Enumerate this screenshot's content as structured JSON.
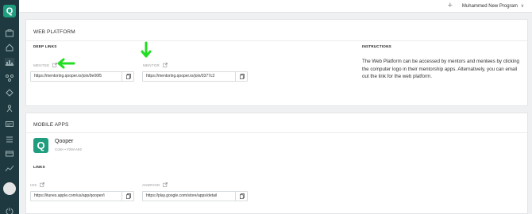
{
  "sidebar": {
    "logo_letter": "Q",
    "items": [
      "portfolio-icon",
      "home-icon",
      "chart-icon",
      "network-icon",
      "goals-icon",
      "person-icon",
      "message-icon",
      "list-icon",
      "card-icon",
      "table-icon",
      "analytics-icon"
    ]
  },
  "topbar": {
    "plus": "+",
    "program_label": "Muhammed New Program",
    "chevron": "∨"
  },
  "web_platform": {
    "title": "WEB PLATFORM",
    "deep_links_label": "DEEP LINKS",
    "mentee_label": "MENTEE",
    "mentee_link": "https://mentoring.qooper.io/join/9e06f5",
    "mentor_label": "MENTOR",
    "mentor_link": "https://mentoring.qooper.io/join/0377c3",
    "instructions_label": "INSTRUCTIONS",
    "instructions_text": "The Web Platform can be accessed by mentors and mentees by clicking the computer logo in their mentorship apps. Alternatively, you can email out the link for the web platform."
  },
  "mobile_apps": {
    "title": "MOBILE APPS",
    "app_logo_letter": "Q",
    "app_name": "Qooper",
    "color_line": "Color  •  #28AA92",
    "links_label": "LINKS",
    "ios_label": "IOS",
    "ios_link": "https://itunes.apple.com/us/app/qooper/i",
    "android_label": "ANDROID",
    "android_link": "https://play.google.com/store/apps/detail"
  },
  "colors": {
    "sidebar": "#1e3a40",
    "brand": "#1e9e7e",
    "arrow": "#22dd22"
  }
}
